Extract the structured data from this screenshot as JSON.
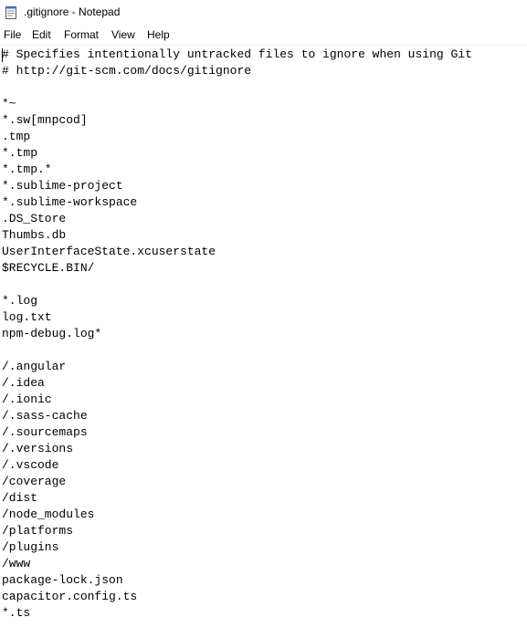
{
  "window": {
    "title": ".gitignore - Notepad"
  },
  "menu": {
    "file": "File",
    "edit": "Edit",
    "format": "Format",
    "view": "View",
    "help": "Help"
  },
  "editor": {
    "lines": [
      "# Specifies intentionally untracked files to ignore when using Git",
      "# http://git-scm.com/docs/gitignore",
      "",
      "*~",
      "*.sw[mnpcod]",
      ".tmp",
      "*.tmp",
      "*.tmp.*",
      "*.sublime-project",
      "*.sublime-workspace",
      ".DS_Store",
      "Thumbs.db",
      "UserInterfaceState.xcuserstate",
      "$RECYCLE.BIN/",
      "",
      "*.log",
      "log.txt",
      "npm-debug.log*",
      "",
      "/.angular",
      "/.idea",
      "/.ionic",
      "/.sass-cache",
      "/.sourcemaps",
      "/.versions",
      "/.vscode",
      "/coverage",
      "/dist",
      "/node_modules",
      "/platforms",
      "/plugins",
      "/www",
      "package-lock.json",
      "capacitor.config.ts",
      "*.ts"
    ]
  }
}
